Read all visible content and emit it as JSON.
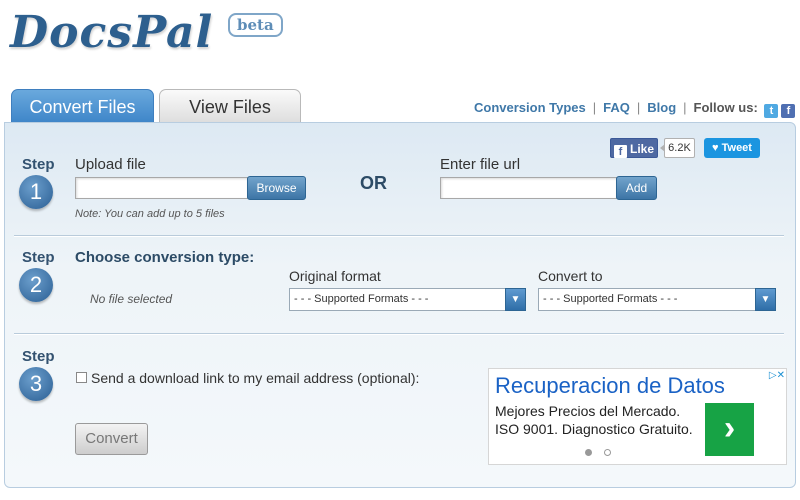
{
  "logo": {
    "text": "DocsPal",
    "badge": "beta"
  },
  "tabs": [
    {
      "label": "Convert Files",
      "active": true
    },
    {
      "label": "View Files",
      "active": false
    }
  ],
  "nav": {
    "links": [
      "Conversion Types",
      "FAQ",
      "Blog"
    ],
    "follow_label": "Follow us:",
    "icons": [
      "twitter-icon",
      "facebook-icon"
    ]
  },
  "social": {
    "like_label": "Like",
    "like_count": "6.2K",
    "tweet_label": "Tweet"
  },
  "step1": {
    "step_label": "Step",
    "number": "1",
    "upload_label": "Upload file",
    "browse_label": "Browse",
    "note": "Note: You can add up to 5 files",
    "or_label": "OR",
    "url_label": "Enter file url",
    "add_label": "Add",
    "upload_value": "",
    "url_value": ""
  },
  "step2": {
    "step_label": "Step",
    "number": "2",
    "title": "Choose conversion type:",
    "no_file": "No file selected",
    "original_label": "Original format",
    "convert_label": "Convert to",
    "original_selected": "- - - Supported Formats - - -",
    "convert_selected": "- - - Supported Formats - - -"
  },
  "step3": {
    "step_label": "Step",
    "number": "3",
    "email_option": "Send a download link to my email address (optional):",
    "email_checked": false,
    "convert_button": "Convert"
  },
  "ad": {
    "title": "Recuperacion de Datos",
    "line1": "Mejores Precios del Mercado.",
    "line2": "ISO 9001. Diagnostico Gratuito.",
    "choices_icon": "adchoices-icon",
    "go_icon": "chevron-right-icon"
  },
  "colors": {
    "brand": "#2d5f8e",
    "tab_active": "#3f86c9",
    "link": "#3f78a8",
    "ad_green": "#17a345"
  }
}
